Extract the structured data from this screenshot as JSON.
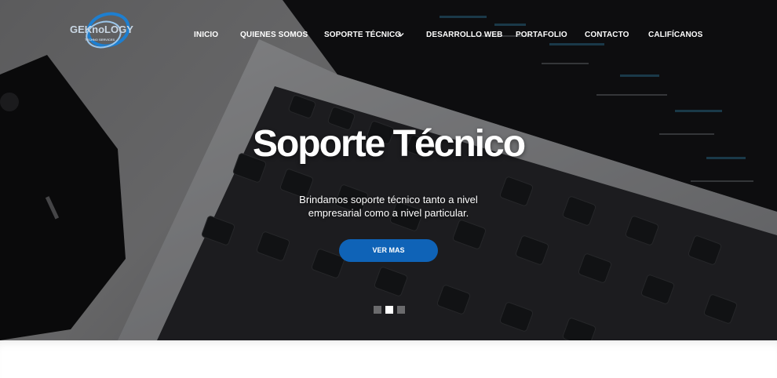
{
  "brand": {
    "logo_text": "GEKnoLOGY",
    "logo_tagline": "TECHNO SERVICES",
    "logo_color": "#1e7fd0"
  },
  "nav": {
    "items": [
      {
        "label": "INICIO"
      },
      {
        "label": "QUIENES SOMOS"
      },
      {
        "label": "SOPORTE TÉCNICO",
        "dropdown": true
      },
      {
        "label": "DESARROLLO WEB"
      },
      {
        "label": "PORTAFOLIO"
      },
      {
        "label": "CONTACTO"
      },
      {
        "label": "CALIFÍCANOS"
      }
    ]
  },
  "hero": {
    "title": "Soporte Técnico",
    "subtitle": "Brindamos soporte técnico tanto a nivel empresarial como a nivel particular.",
    "cta_label": "VER MAS",
    "cta_color": "#0f63b7",
    "slides_total": 3,
    "active_slide": 2
  }
}
